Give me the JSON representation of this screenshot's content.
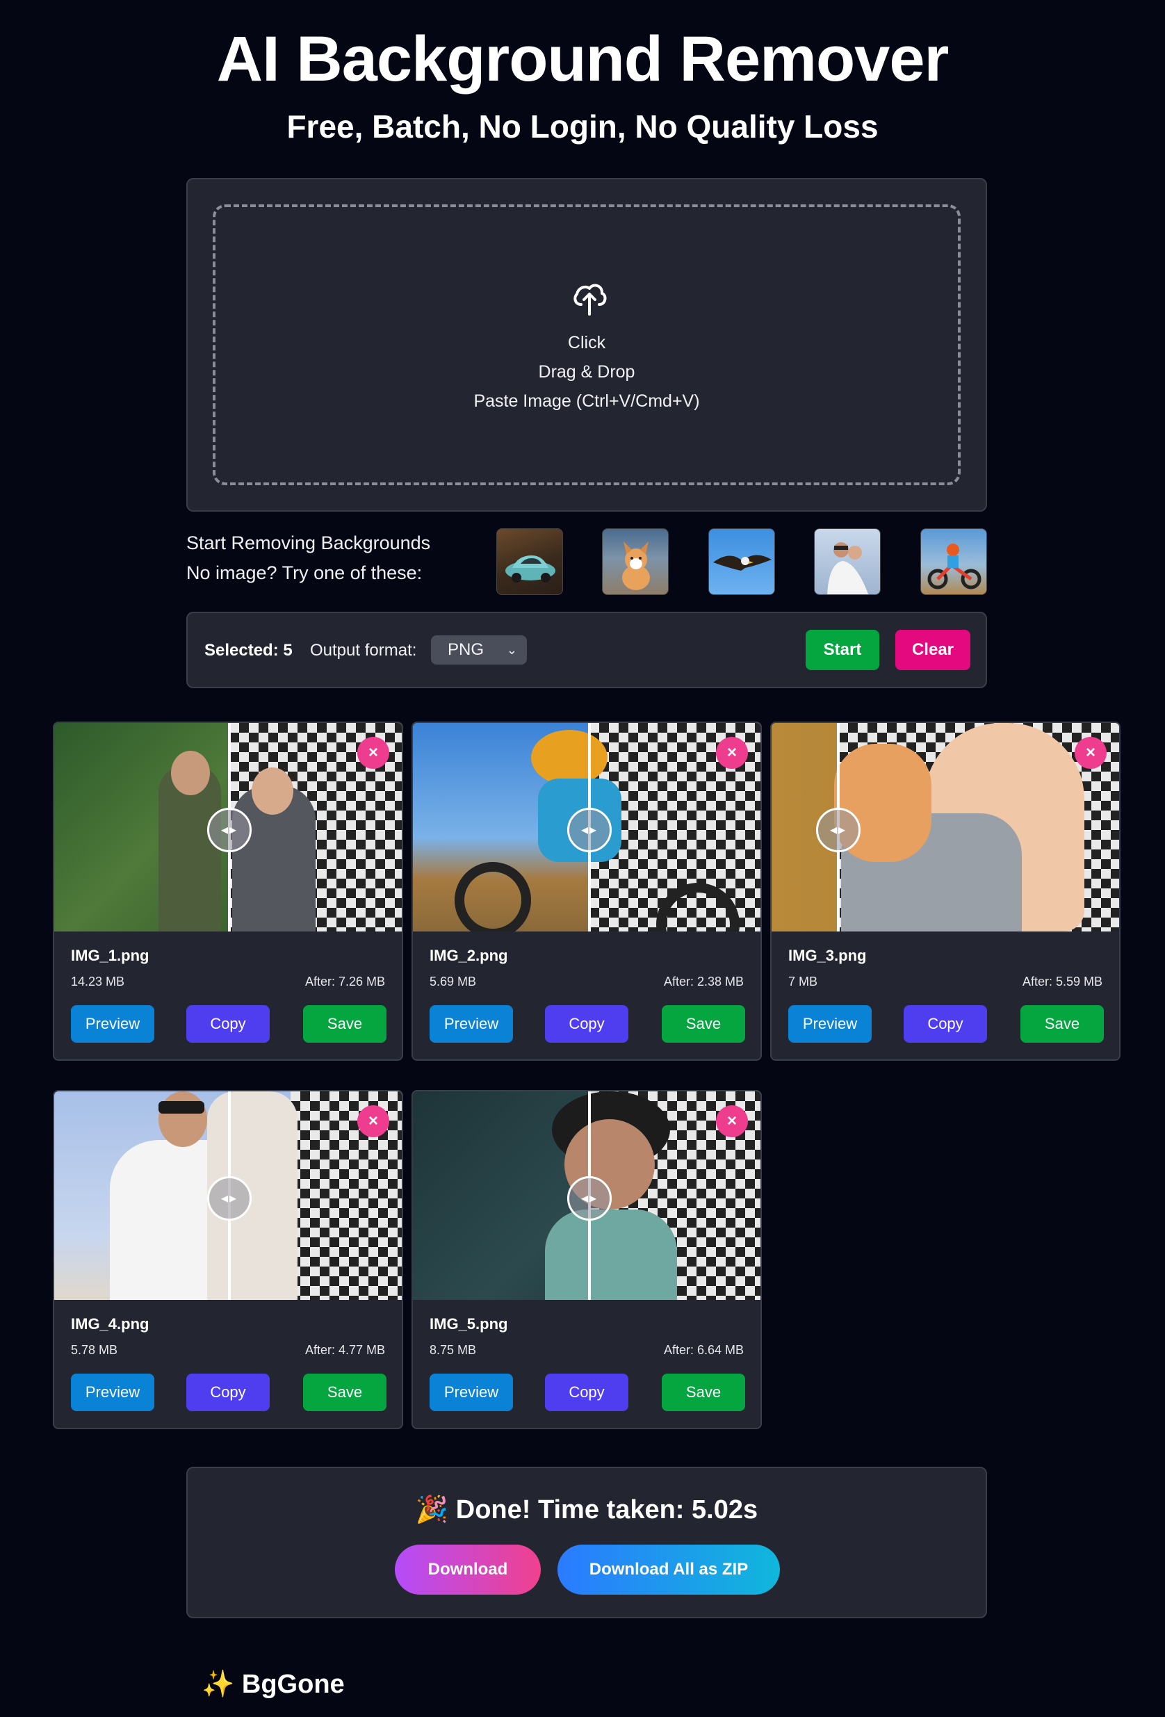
{
  "header": {
    "title": "AI Background Remover",
    "subtitle": "Free, Batch, No Login, No Quality Loss"
  },
  "upload": {
    "icon": "cloud-upload-icon",
    "line1": "Click",
    "line2": "Drag & Drop",
    "line3": "Paste Image (Ctrl+V/Cmd+V)"
  },
  "samples": {
    "heading": "Start Removing Backgrounds",
    "prompt": "No image? Try one of these:",
    "items": [
      "sample-car",
      "sample-dog",
      "sample-eagle",
      "sample-couple",
      "sample-motocross"
    ]
  },
  "toolbar": {
    "selected_label": "Selected: 5",
    "format_label": "Output format:",
    "format_value": "PNG",
    "start_label": "Start",
    "clear_label": "Clear"
  },
  "results": [
    {
      "name": "IMG_1.png",
      "size": "14.23 MB",
      "after": "After: 7.26 MB"
    },
    {
      "name": "IMG_2.png",
      "size": "5.69 MB",
      "after": "After: 2.38 MB"
    },
    {
      "name": "IMG_3.png",
      "size": "7 MB",
      "after": "After: 5.59 MB"
    },
    {
      "name": "IMG_4.png",
      "size": "5.78 MB",
      "after": "After: 4.77 MB"
    },
    {
      "name": "IMG_5.png",
      "size": "8.75 MB",
      "after": "After: 6.64 MB"
    }
  ],
  "card_buttons": {
    "preview": "Preview",
    "copy": "Copy",
    "save": "Save",
    "remove": "×",
    "handle": "◂▸"
  },
  "done": {
    "emoji": "🎉",
    "message": "Done! Time taken: 5.02s",
    "download_label": "Download",
    "zip_label": "Download All as ZIP"
  },
  "footer": {
    "brand_icon": "✨",
    "brand": "BgGone"
  },
  "colors": {
    "background": "#040713",
    "panel": "#232630",
    "start": "#05a640",
    "clear": "#e5097f",
    "preview": "#0a82d6",
    "copy": "#4f3ef0",
    "save": "#05a640",
    "remove": "#ee3d8f"
  }
}
